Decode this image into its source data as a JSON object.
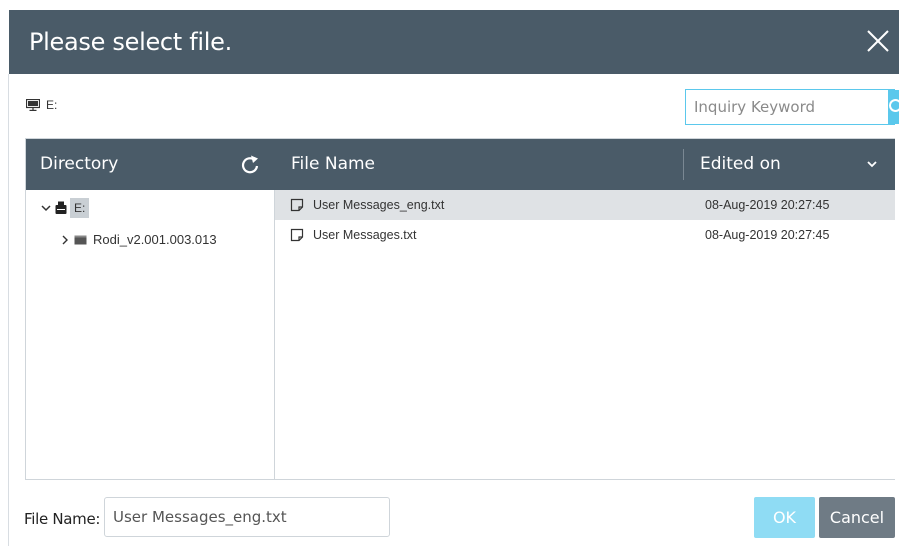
{
  "dialog": {
    "title": "Please select file."
  },
  "location": {
    "drive_label": "E:"
  },
  "search": {
    "placeholder": "Inquiry Keyword",
    "value": ""
  },
  "directory": {
    "header": "Directory",
    "tree": {
      "root_label": "E:",
      "root_expanded": true,
      "children": [
        {
          "label": "Rodi_v2.001.003.013",
          "expanded": false
        }
      ]
    }
  },
  "files": {
    "columns": {
      "name": "File Name",
      "edited": "Edited on"
    },
    "rows": [
      {
        "name": "User Messages_eng.txt",
        "edited": "08-Aug-2019 20:27:45",
        "selected": true
      },
      {
        "name": "User Messages.txt",
        "edited": "08-Aug-2019 20:27:45",
        "selected": false
      }
    ]
  },
  "footer": {
    "file_name_label": "File Name:",
    "file_name_value": "User Messages_eng.txt",
    "ok_label": "OK",
    "cancel_label": "Cancel"
  },
  "colors": {
    "header_bg": "#4a5b68",
    "accent": "#5bc8ec",
    "ok_disabled": "#8fdcf4",
    "cancel_bg": "#6f7b85",
    "selected_row": "#dfe2e5"
  },
  "icons": {
    "close": "close-icon",
    "monitor": "monitor-icon",
    "search": "search-icon",
    "refresh": "refresh-icon",
    "sort": "chevron-down-icon",
    "drive": "usb-drive-icon",
    "folder": "folder-icon",
    "file": "file-icon"
  }
}
